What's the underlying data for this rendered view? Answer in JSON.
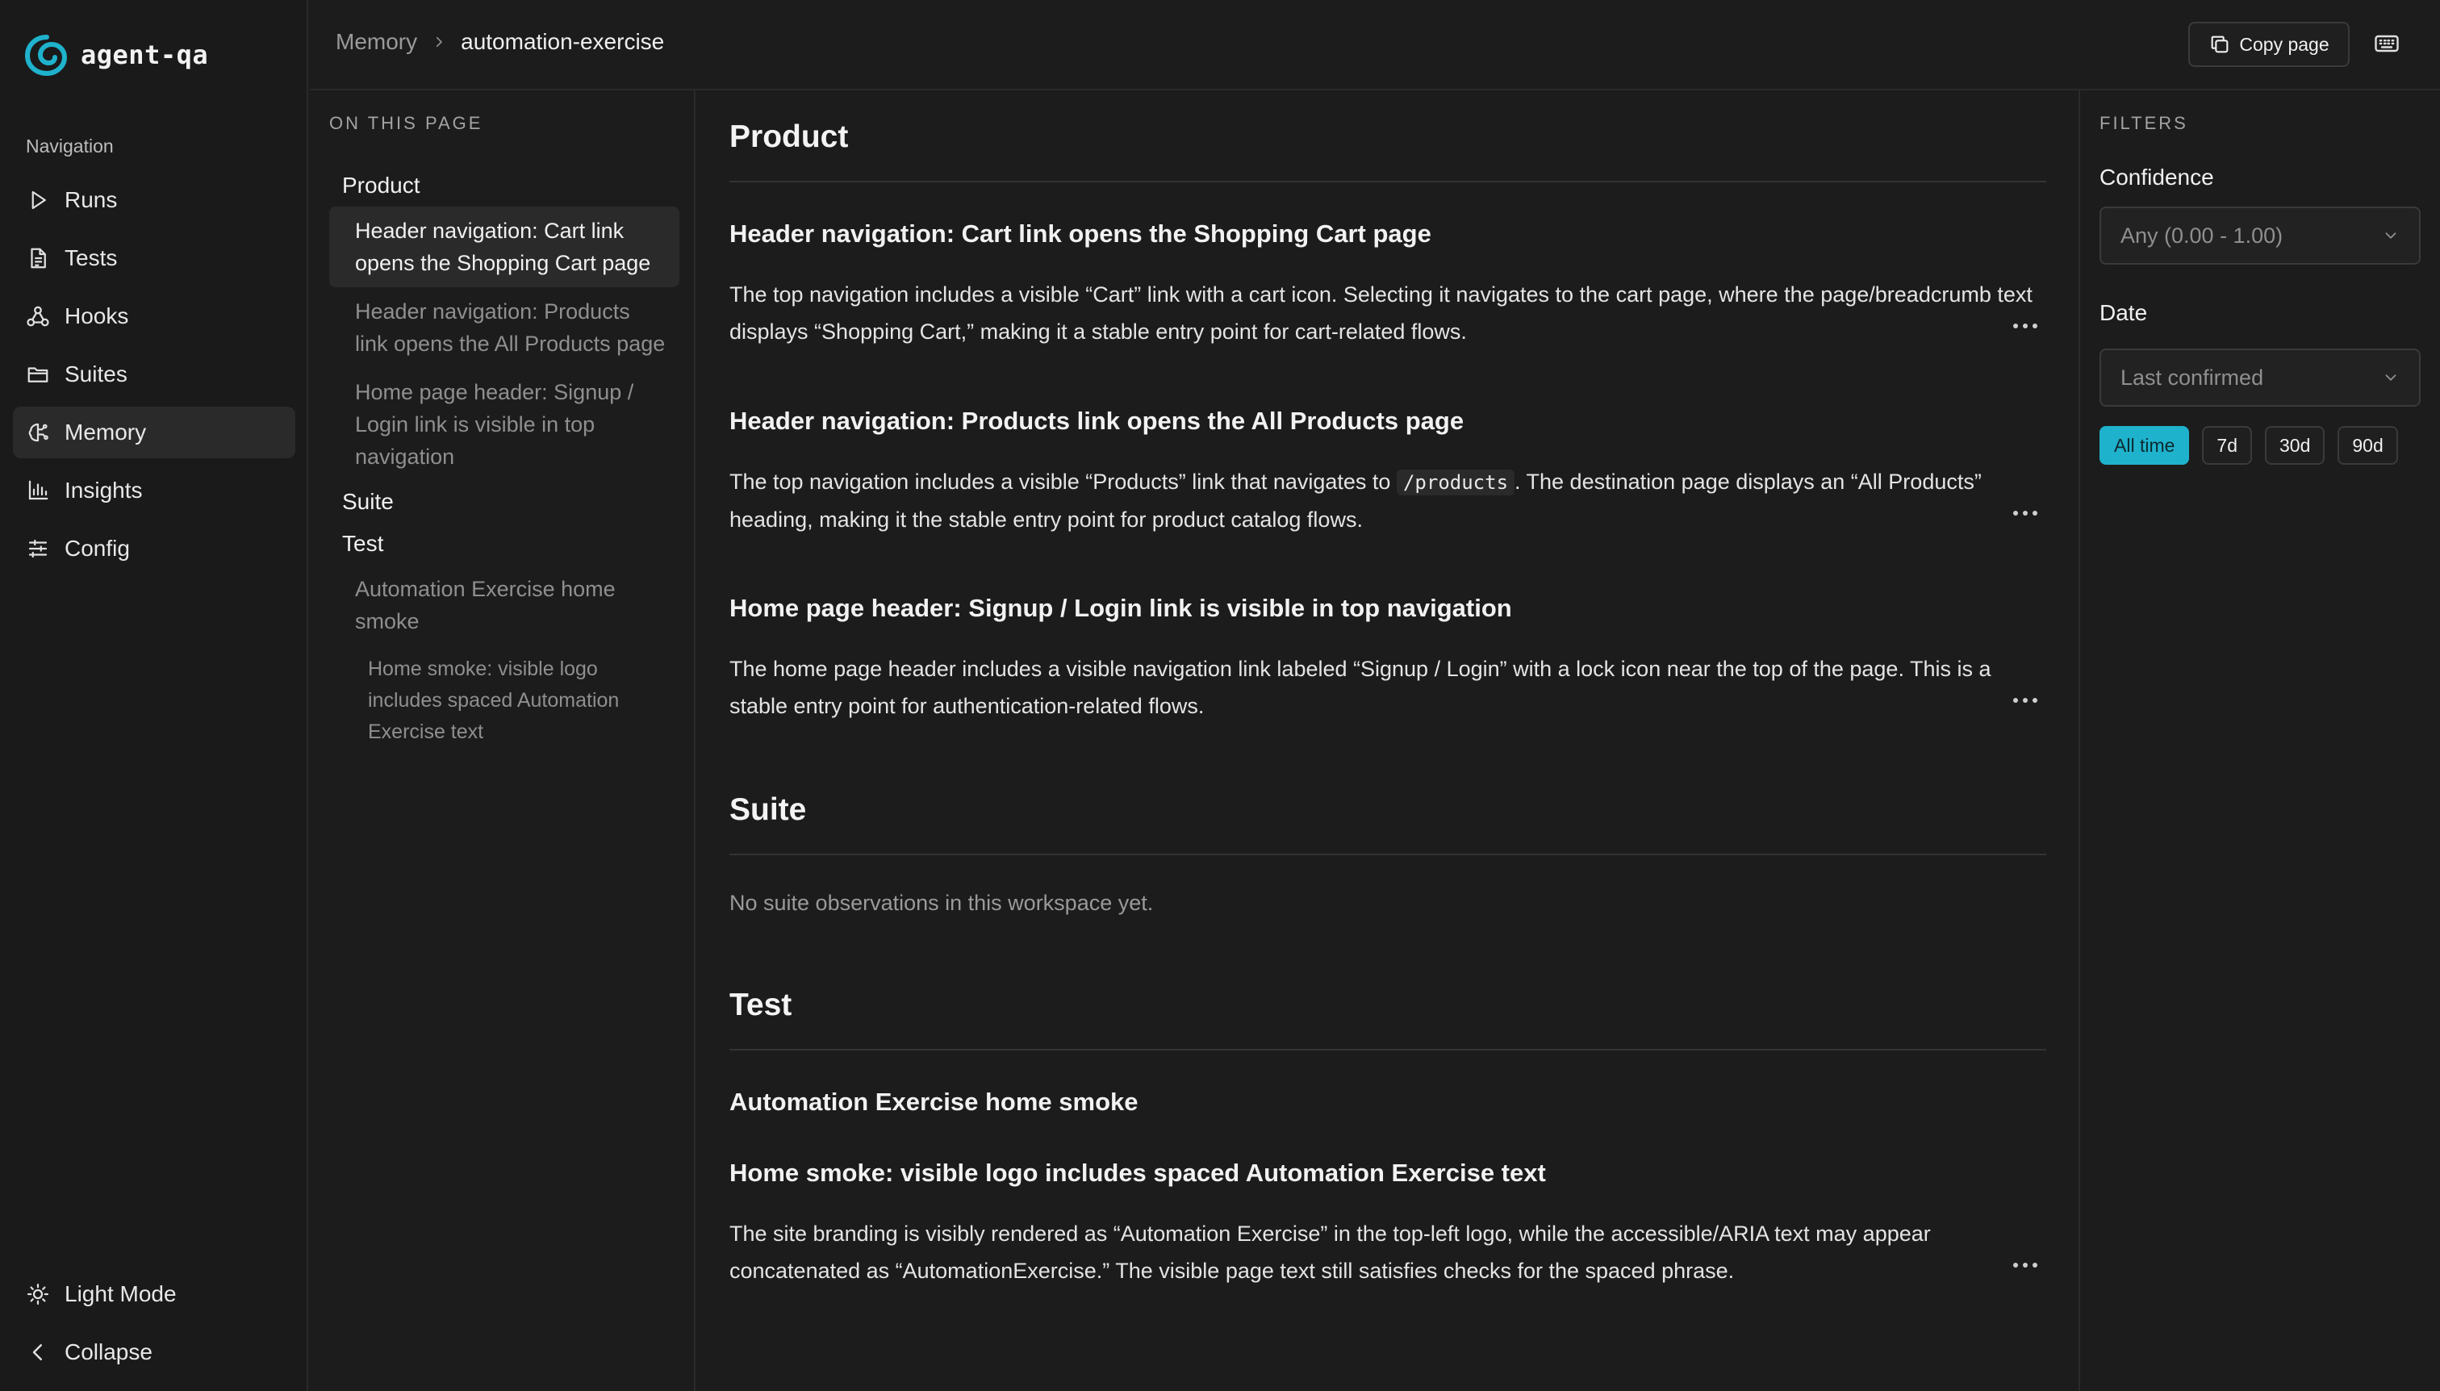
{
  "app": {
    "name": "agent-qa",
    "accent": "#1fb2cc"
  },
  "sidebar": {
    "heading": "Navigation",
    "items": [
      {
        "label": "Runs",
        "icon": "play-icon"
      },
      {
        "label": "Tests",
        "icon": "file-icon"
      },
      {
        "label": "Hooks",
        "icon": "webhook-icon"
      },
      {
        "label": "Suites",
        "icon": "folder-icon"
      },
      {
        "label": "Memory",
        "icon": "brain-icon",
        "active": true
      },
      {
        "label": "Insights",
        "icon": "bar-chart-icon"
      },
      {
        "label": "Config",
        "icon": "sliders-icon"
      }
    ],
    "bottom": {
      "light_mode": "Light Mode",
      "collapse": "Collapse"
    }
  },
  "topbar": {
    "breadcrumb_parent": "Memory",
    "breadcrumb_current": "automation-exercise",
    "copy_label": "Copy page"
  },
  "toc": {
    "heading": "ON THIS PAGE",
    "sections": {
      "product": "Product",
      "suite": "Suite",
      "test": "Test"
    },
    "items": {
      "cart": "Header navigation: Cart link opens the Shopping Cart page",
      "products": "Header navigation: Products link opens the All Products page",
      "signup": "Home page header: Signup / Login link is visible in top navigation",
      "home_smoke": "Automation Exercise home smoke",
      "logo": "Home smoke: visible logo includes spaced Automation Exercise text"
    }
  },
  "main": {
    "product": {
      "title": "Product",
      "entries": [
        {
          "title": "Header navigation: Cart link opens the Shopping Cart page",
          "body": "The top navigation includes a visible “Cart” link with a cart icon. Selecting it navigates to the cart page, where the page/breadcrumb text displays “Shopping Cart,” making it a stable entry point for cart-related flows."
        },
        {
          "title": "Header navigation: Products link opens the All Products page",
          "body_before": "The top navigation includes a visible “Products” link that navigates to",
          "code": "/products",
          "body_after": ". The destination page displays an “All Products” heading, making it the stable entry point for product catalog flows."
        },
        {
          "title": "Home page header: Signup / Login link is visible in top navigation",
          "body": "The home page header includes a visible navigation link labeled “Signup / Login” with a lock icon near the top of the page. This is a stable entry point for authentication-related flows."
        }
      ]
    },
    "suite": {
      "title": "Suite",
      "empty": "No suite observations in this workspace yet."
    },
    "test": {
      "title": "Test",
      "subsection": "Automation Exercise home smoke",
      "entry": {
        "title": "Home smoke: visible logo includes spaced Automation Exercise text",
        "body": "The site branding is visibly rendered as “Automation Exercise” in the top-left logo, while the accessible/ARIA text may appear concatenated as “AutomationExercise.” The visible page text still satisfies checks for the spaced phrase."
      }
    }
  },
  "filters": {
    "heading": "FILTERS",
    "confidence_label": "Confidence",
    "confidence_value": "Any (0.00 - 1.00)",
    "date_label": "Date",
    "date_value": "Last confirmed",
    "ranges": [
      "All time",
      "7d",
      "30d",
      "90d"
    ],
    "active_range": "All time"
  }
}
